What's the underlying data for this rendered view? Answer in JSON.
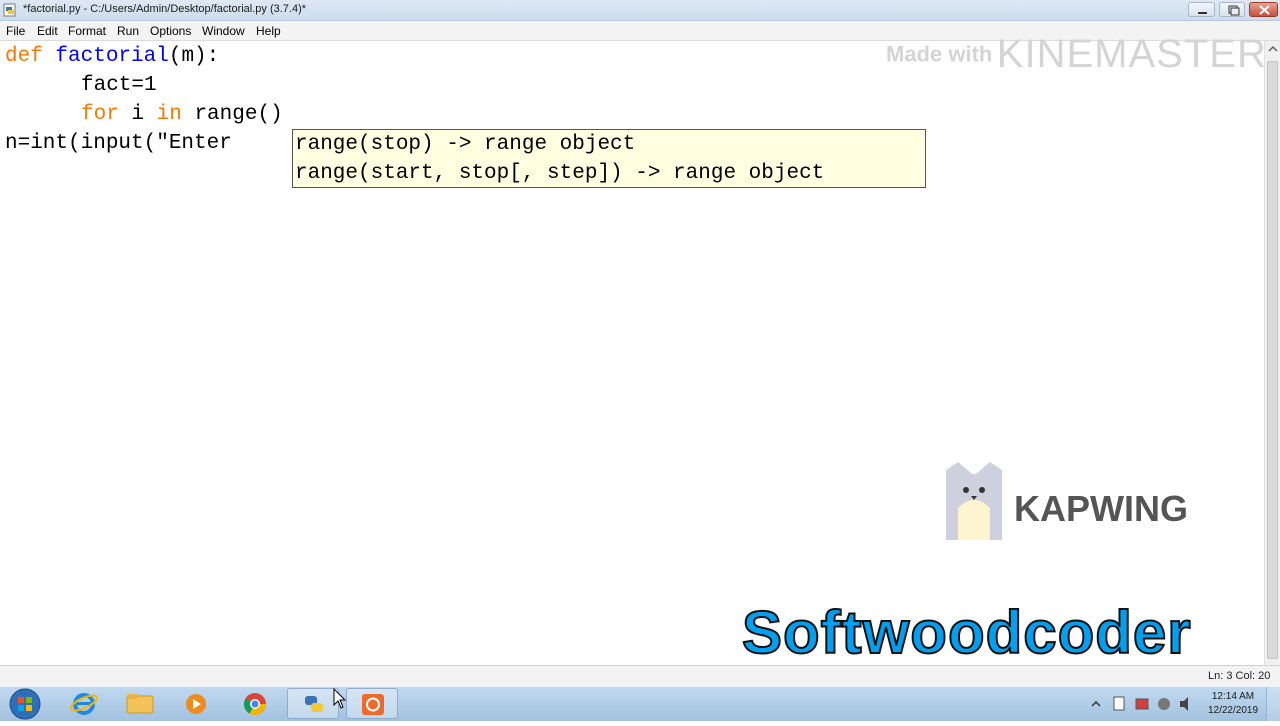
{
  "window": {
    "title": "*factorial.py - C:/Users/Admin/Desktop/factorial.py (3.7.4)*"
  },
  "menu": [
    "File",
    "Edit",
    "Format",
    "Run",
    "Options",
    "Window",
    "Help"
  ],
  "code": {
    "line1": {
      "kw": "def",
      "name": " factorial",
      "rest": "(m):"
    },
    "line2": {
      "text": "fact=1"
    },
    "line3": {
      "kw1": "for",
      "mid": " i ",
      "kw2": "in",
      "sp": " ",
      "call": "range",
      "rest": "()"
    },
    "line4": {
      "text": "n=int(input(\"Enter "
    }
  },
  "calltip": {
    "line1": "range(stop) -> range object",
    "line2": "range(start, stop[, step]) -> range object"
  },
  "status": {
    "position": "Ln: 3   Col: 20"
  },
  "taskbar": {
    "apps": [
      "windows-start",
      "internet-explorer",
      "file-explorer",
      "media-player",
      "chrome",
      "python-idle",
      "kinemaster"
    ],
    "clock_time": "12:14 AM",
    "clock_date": "12/22/2019"
  },
  "watermarks": {
    "made_with": "Made with",
    "kinemaster": "KINEMASTER",
    "kapwing": "KAPWING",
    "softwoodcoder": "Softwoodcoder"
  },
  "colors": {
    "keyword": "#ff7700",
    "builtin": "#0000ff",
    "calltip_bg": "#ffffe1",
    "softwood": "#00a0f0"
  }
}
